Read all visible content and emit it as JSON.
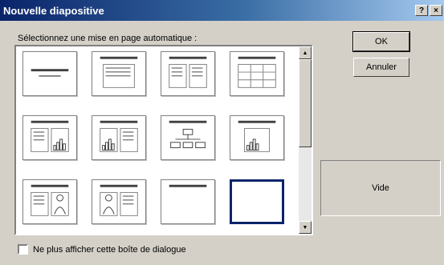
{
  "window": {
    "title": "Nouvelle diapositive",
    "help_label": "?",
    "close_label": "×"
  },
  "prompt": "Sélectionnez une mise en page automatique :",
  "buttons": {
    "ok": "OK",
    "cancel": "Annuler"
  },
  "preview": {
    "label": "Vide"
  },
  "checkbox": {
    "label": "Ne plus afficher cette boîte de dialogue",
    "checked": false
  },
  "layouts": [
    {
      "kind": "title"
    },
    {
      "kind": "bullet-list"
    },
    {
      "kind": "two-column-text"
    },
    {
      "kind": "table"
    },
    {
      "kind": "text-and-chart"
    },
    {
      "kind": "chart-and-text"
    },
    {
      "kind": "org-chart"
    },
    {
      "kind": "chart"
    },
    {
      "kind": "text-and-clip-art"
    },
    {
      "kind": "clip-art-and-text"
    },
    {
      "kind": "title-only"
    },
    {
      "kind": "blank",
      "selected": true
    }
  ],
  "scrollbar": {
    "up_icon": "arrow-up-icon",
    "down_icon": "arrow-down-icon"
  }
}
